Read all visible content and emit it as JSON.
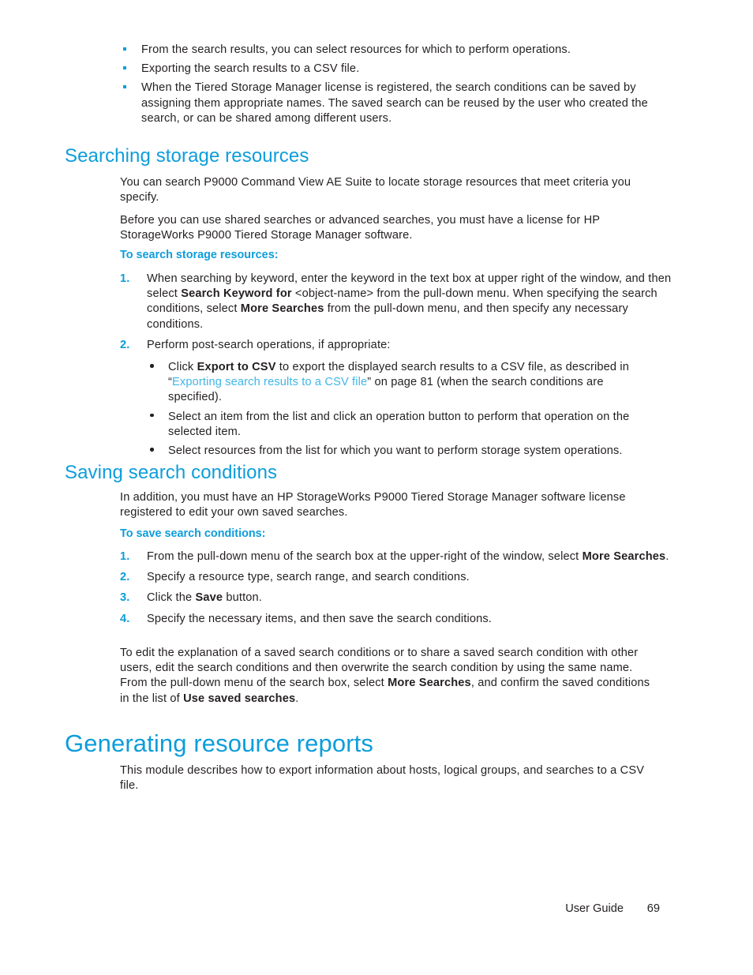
{
  "colors": {
    "heading_blue": "#0d9ddb",
    "link_blue": "#3eb6e8",
    "body_black": "#231f20"
  },
  "top_bullets": {
    "items": [
      "From the search results, you can select resources for which to perform operations.",
      "Exporting the search results to a CSV file.",
      "When the Tiered Storage Manager license is registered, the search conditions can be saved by assigning them appropriate names. The saved search can be reused by the user who created the search, or can be shared among different users."
    ]
  },
  "section_searching": {
    "heading": "Searching storage resources",
    "paragraph_1": "You can search P9000 Command View AE Suite to locate storage resources that meet criteria you specify.",
    "paragraph_2": "Before you can use shared searches or advanced searches, you must have a license for HP StorageWorks P9000 Tiered Storage Manager software.",
    "subheading": "To search storage resources:",
    "steps": [
      {
        "number": "1.",
        "parts": [
          {
            "text": "When searching by keyword, enter the keyword in the text box at upper right of the window, and then select ",
            "style": "normal"
          },
          {
            "text": "Search Keyword for",
            "style": "bold"
          },
          {
            "text": " <object-name> from the pull-down menu. When specifying the search conditions, select ",
            "style": "normal"
          },
          {
            "text": "More Searches",
            "style": "bold"
          },
          {
            "text": " from the pull-down menu, and then specify any necessary conditions.",
            "style": "normal"
          }
        ]
      },
      {
        "number": "2.",
        "parts": [
          {
            "text": "Perform post-search operations, if appropriate:",
            "style": "normal"
          }
        ]
      }
    ],
    "sub_bullets": [
      {
        "parts": [
          {
            "text": "Click ",
            "style": "normal"
          },
          {
            "text": "Export to CSV",
            "style": "bold"
          },
          {
            "text": " to export the displayed search results to a CSV file, as described in “",
            "style": "normal"
          },
          {
            "text": "Exporting search results to a CSV file",
            "style": "link"
          },
          {
            "text": "” on page 81 (when the search conditions are specified).",
            "style": "normal"
          }
        ]
      },
      {
        "parts": [
          {
            "text": "Select an item from the list and click an operation button to perform that operation on the selected item.",
            "style": "normal"
          }
        ]
      },
      {
        "parts": [
          {
            "text": "Select resources from the list for which you want to perform storage system operations.",
            "style": "normal"
          }
        ]
      }
    ]
  },
  "section_saving": {
    "heading": "Saving search conditions",
    "paragraph_1": "In addition, you must have an HP StorageWorks P9000 Tiered Storage Manager software license registered to edit your own saved searches.",
    "subheading": "To save search conditions:",
    "steps": [
      {
        "number": "1.",
        "parts": [
          {
            "text": "From the pull-down menu of the search box at the upper-right of the window, select ",
            "style": "normal"
          },
          {
            "text": "More Searches",
            "style": "bold"
          },
          {
            "text": ".",
            "style": "normal"
          }
        ]
      },
      {
        "number": "2.",
        "parts": [
          {
            "text": "Specify a resource type, search range, and search conditions.",
            "style": "normal"
          }
        ]
      },
      {
        "number": "3.",
        "parts": [
          {
            "text": "Click the ",
            "style": "normal"
          },
          {
            "text": "Save",
            "style": "bold"
          },
          {
            "text": " button.",
            "style": "normal"
          }
        ]
      },
      {
        "number": "4.",
        "parts": [
          {
            "text": "Specify the necessary items, and then save the search conditions.",
            "style": "normal"
          }
        ]
      }
    ],
    "closing_paragraph": [
      {
        "text": "To edit the explanation of a saved search conditions or to share a saved search condition with other users, edit the search conditions and then overwrite the search condition by using the same name. From the pull-down menu of the search box, select ",
        "style": "normal"
      },
      {
        "text": "More Searches",
        "style": "bold"
      },
      {
        "text": ", and confirm the saved conditions in the list of ",
        "style": "normal"
      },
      {
        "text": "Use saved searches",
        "style": "bold"
      },
      {
        "text": ".",
        "style": "normal"
      }
    ]
  },
  "section_generating": {
    "heading": "Generating resource reports",
    "paragraph_1": "This module describes how to export information about hosts, logical groups, and searches to a CSV file."
  },
  "footer": {
    "label": "User Guide",
    "page_number": "69"
  }
}
